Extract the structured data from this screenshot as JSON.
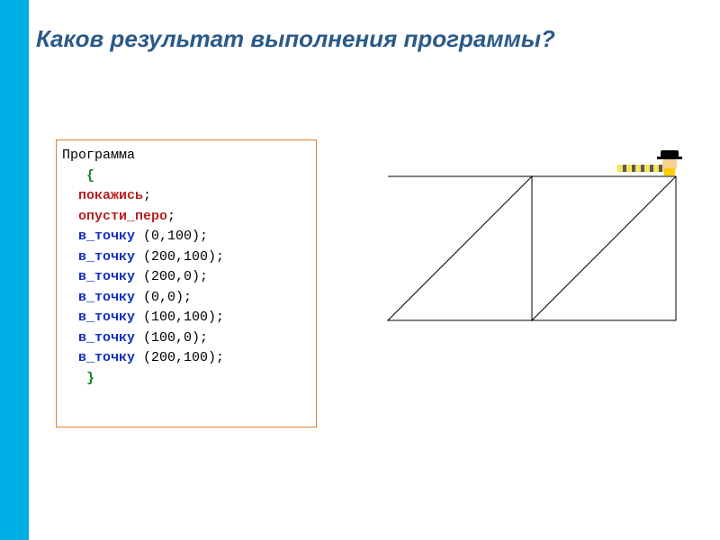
{
  "title": "Каков результат выполнения программы?",
  "code": {
    "header": "Программа",
    "open_brace": "   {",
    "close_brace": "   }",
    "cmd1": "  покажись",
    "cmd2": "  опусти_перо",
    "kw": "  в_точку",
    "semicolon": ";",
    "lines": [
      {
        "args": " (0,100);"
      },
      {
        "args": " (200,100);"
      },
      {
        "args": " (200,0);"
      },
      {
        "args": " (0,0);"
      },
      {
        "args": " (100,100);"
      },
      {
        "args": " (100,0);"
      },
      {
        "args": " (200,100);"
      }
    ]
  },
  "chart_data": {
    "type": "line",
    "title": "",
    "xlabel": "",
    "ylabel": "",
    "xlim": [
      0,
      200
    ],
    "ylim": [
      0,
      100
    ],
    "path": [
      [
        0,
        100
      ],
      [
        200,
        100
      ],
      [
        200,
        0
      ],
      [
        0,
        0
      ],
      [
        100,
        100
      ],
      [
        100,
        0
      ],
      [
        200,
        100
      ]
    ],
    "note": "y axis points upward; origin lower-left"
  }
}
